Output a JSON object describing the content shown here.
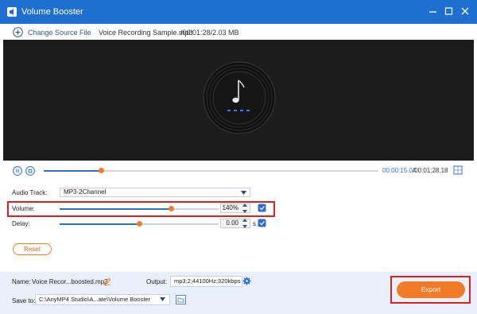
{
  "window": {
    "title": "Volume Booster",
    "app_icon": "app-icon",
    "controls": [
      "minimize-icon",
      "maximize-icon",
      "close-icon"
    ]
  },
  "toolbar": {
    "change_source_label": "Change Source File",
    "file_name": "Voice Recording Sample.mp3",
    "file_info": "/00:01:28/2.03 MB"
  },
  "player": {
    "progress_fraction": 0.17,
    "current_time": "00:00:15.04",
    "total_time": "/00:01:28.18"
  },
  "settings": {
    "audio_track": {
      "label": "Audio Track:",
      "value": "MP3-2Channel"
    },
    "volume": {
      "label": "Volume:",
      "value": "140%",
      "level_fraction": 0.7
    },
    "delay": {
      "label": "Delay:",
      "value": "0.00",
      "unit": "s",
      "level_fraction": 0.5
    },
    "reset_label": "Reset"
  },
  "bottom": {
    "name_label": "Name:",
    "name_value": "Voice Recor...boosted.mp3",
    "output_label": "Output:",
    "output_value": "mp3;2;44100Hz;320kbps",
    "save_label": "Save to:",
    "save_path": "C:\\AnyMP4 Studio\\A...ate\\Volume Booster",
    "export_label": "Export"
  },
  "colors": {
    "titlebar": "#1f6fd1",
    "accent_orange": "#f27b28",
    "highlight_red": "#e0201f",
    "progress_blue": "#2f6fd0"
  }
}
